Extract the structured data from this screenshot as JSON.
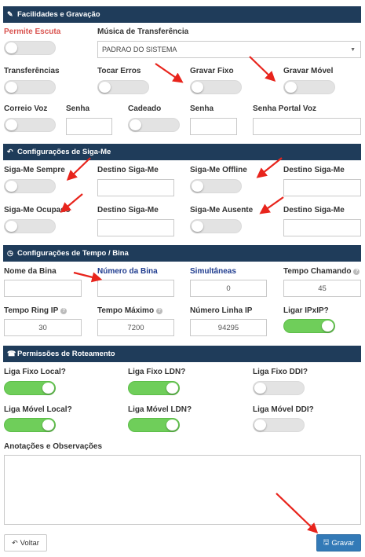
{
  "sections": {
    "facilidades": {
      "title": "Facilidades e Gravação",
      "icon": "wrench-icon",
      "glyph": "✎"
    },
    "sigame": {
      "title": "Configurações de Siga-Me",
      "icon": "reply-icon",
      "glyph": "↶"
    },
    "tempo": {
      "title": "Configurações de Tempo / Bina",
      "icon": "clock-icon",
      "glyph": "◷"
    },
    "roteamento": {
      "title": "Permissões de Roteamento",
      "icon": "phone-square-icon",
      "glyph": "☎"
    }
  },
  "facilidades": {
    "permite_escuta": {
      "label": "Permite Escuta",
      "on": false
    },
    "musica_label": "Música de Transferência",
    "musica_value": "PADRAO DO SISTEMA",
    "transferencias": {
      "label": "Transferências",
      "on": false
    },
    "tocar_erros": {
      "label": "Tocar Erros",
      "on": false
    },
    "gravar_fixo": {
      "label": "Gravar Fixo",
      "on": false
    },
    "gravar_movel": {
      "label": "Gravar Móvel",
      "on": false
    },
    "correio_voz": {
      "label": "Correio Voz",
      "on": false
    },
    "senha1_label": "Senha",
    "cadeado": {
      "label": "Cadeado",
      "on": false
    },
    "senha2_label": "Senha",
    "senha_portal_label": "Senha Portal Voz"
  },
  "sigame": {
    "sempre": {
      "label": "Siga-Me Sempre",
      "on": false
    },
    "destino1_label": "Destino Siga-Me",
    "offline": {
      "label": "Siga-Me Offline",
      "on": false
    },
    "destino2_label": "Destino Siga-Me",
    "ocupado": {
      "label": "Siga-Me Ocupado",
      "on": false
    },
    "destino3_label": "Destino Siga-Me",
    "ausente": {
      "label": "Siga-Me Ausente",
      "on": false
    },
    "destino4_label": "Destino Siga-Me"
  },
  "tempo": {
    "nome_bina_label": "Nome da Bina",
    "numero_bina_label": "Número da Bina",
    "simultaneas_label": "Simultâneas",
    "simultaneas_value": "0",
    "tempo_chamando_label": "Tempo Chamando",
    "tempo_chamando_value": "45",
    "tempo_ring_label": "Tempo Ring IP",
    "tempo_ring_value": "30",
    "tempo_maximo_label": "Tempo Máximo",
    "tempo_maximo_value": "7200",
    "numero_linha_label": "Número Linha IP",
    "numero_linha_value": "94295",
    "ligar_ipxip": {
      "label": "Ligar IPxIP?",
      "on": true
    }
  },
  "roteamento": {
    "fixo_local": {
      "label": "Liga Fixo Local?",
      "on": true
    },
    "fixo_ldn": {
      "label": "Liga Fixo LDN?",
      "on": true
    },
    "fixo_ddi": {
      "label": "Liga Fixo DDI?",
      "on": false
    },
    "movel_local": {
      "label": "Liga Móvel Local?",
      "on": true
    },
    "movel_ldn": {
      "label": "Liga Móvel LDN?",
      "on": true
    },
    "movel_ddi": {
      "label": "Liga Móvel DDI?",
      "on": false
    }
  },
  "anotacoes_label": "Anotações e Observações",
  "buttons": {
    "voltar": "Voltar",
    "gravar": "Gravar"
  },
  "colors": {
    "header": "#1f3c5a",
    "toggle_on": "#6fce5a",
    "primary": "#337ab7",
    "annotation_arrow": "#e8241c"
  }
}
